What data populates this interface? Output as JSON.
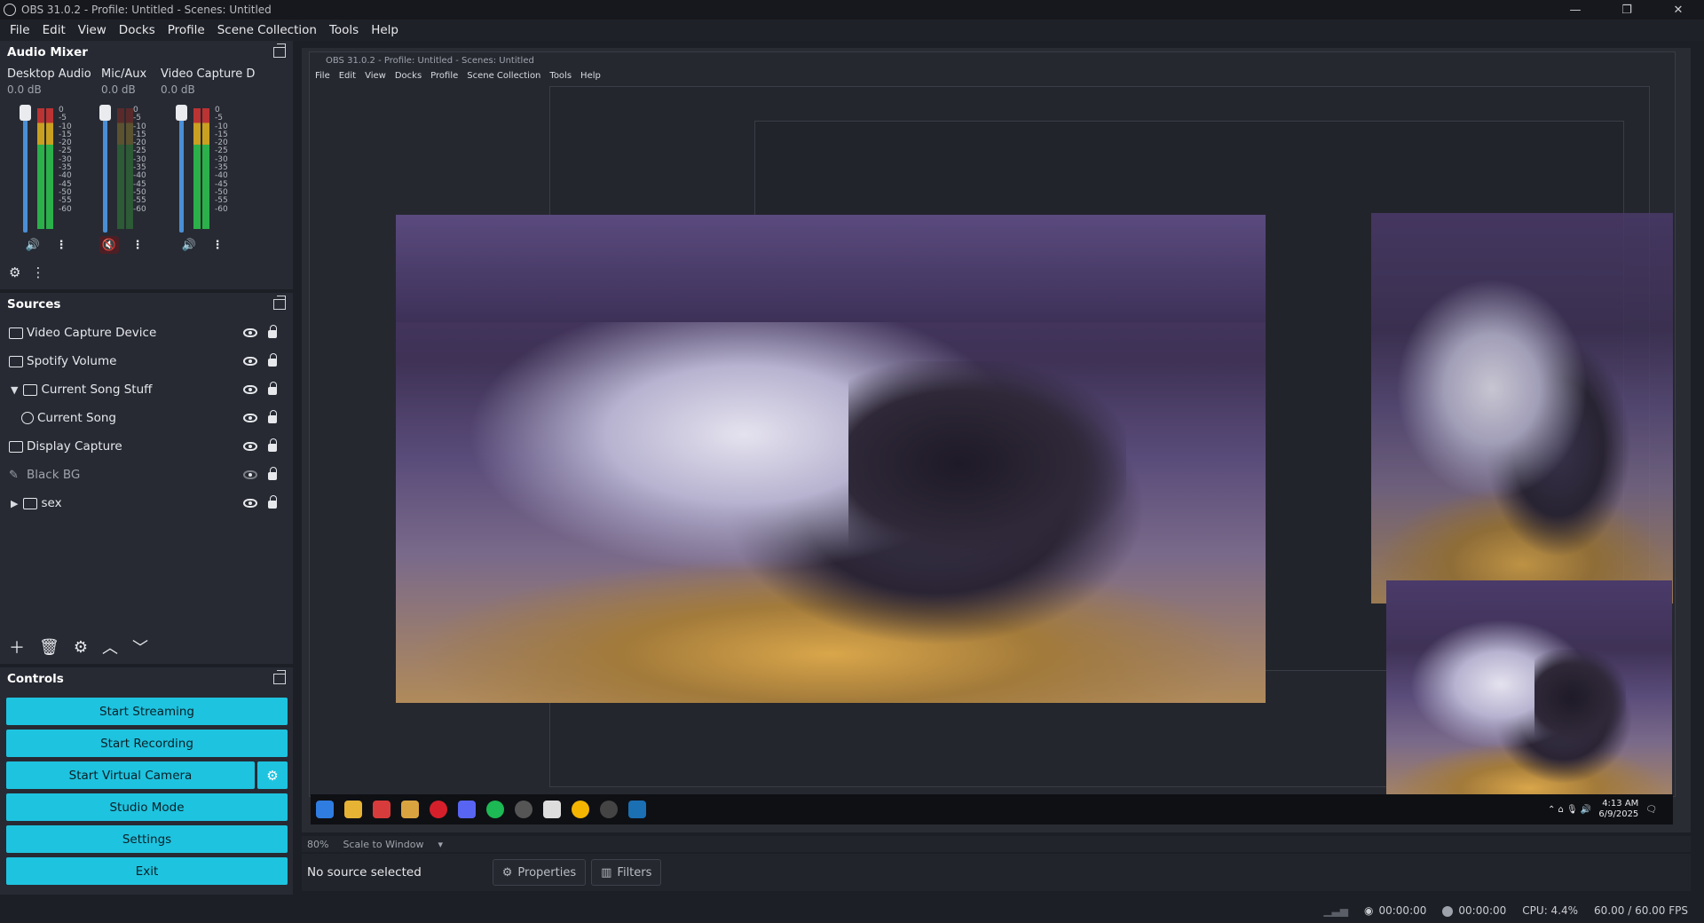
{
  "window": {
    "title": "OBS 31.0.2 - Profile: Untitled - Scenes: Untitled"
  },
  "menu": [
    "File",
    "Edit",
    "View",
    "Docks",
    "Profile",
    "Scene Collection",
    "Tools",
    "Help"
  ],
  "mixer": {
    "title": "Audio Mixer",
    "channels": [
      {
        "name": "Desktop Audio",
        "db": "0.0 dB",
        "muted": false
      },
      {
        "name": "Mic/Aux",
        "db": "0.0 dB",
        "muted": true
      },
      {
        "name": "Video Capture D",
        "db": "0.0 dB",
        "muted": false
      }
    ],
    "scale": [
      "0",
      "-5",
      "-10",
      "-15",
      "-20",
      "-25",
      "-30",
      "-35",
      "-40",
      "-45",
      "-50",
      "-55",
      "-60"
    ]
  },
  "sources": {
    "title": "Sources",
    "items": [
      {
        "label": "Video Capture Device",
        "icon": "camera-icon"
      },
      {
        "label": "Spotify Volume",
        "icon": "window-icon"
      },
      {
        "label": "Current Song Stuff",
        "icon": "folder-icon"
      },
      {
        "label": "Current Song",
        "icon": "globe-icon"
      },
      {
        "label": "Display Capture",
        "icon": "monitor-icon"
      },
      {
        "label": "Black BG",
        "icon": "brush-icon"
      },
      {
        "label": "sex",
        "icon": "folder-icon"
      }
    ]
  },
  "controls": {
    "title": "Controls",
    "start_streaming": "Start Streaming",
    "start_recording": "Start Recording",
    "start_virtual_camera": "Start Virtual Camera",
    "studio_mode": "Studio Mode",
    "settings": "Settings",
    "exit": "Exit"
  },
  "preview": {
    "zoom": "80%",
    "scale_mode": "Scale to Window",
    "no_source": "No source selected",
    "properties": "Properties",
    "filters": "Filters"
  },
  "taskbar": {
    "time": "4:13 AM",
    "date": "6/9/2025"
  },
  "status": {
    "stream_time": "00:00:00",
    "rec_time": "00:00:00",
    "cpu": "CPU: 4.4%",
    "fps": "60.00 / 60.00 FPS"
  }
}
